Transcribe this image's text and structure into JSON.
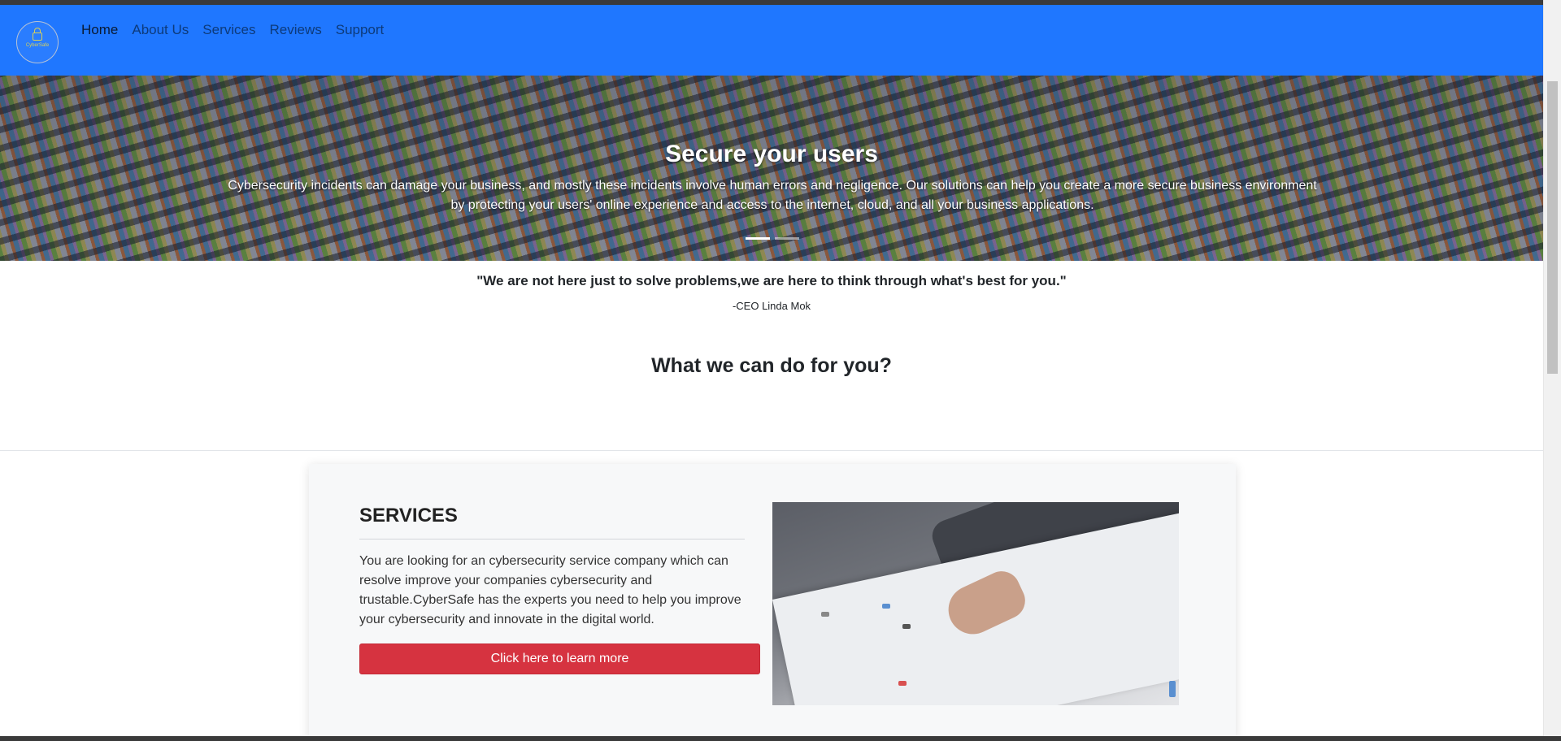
{
  "nav": {
    "logo_text": "CyberSafe",
    "links": [
      "Home",
      "About Us",
      "Services",
      "Reviews",
      "Support"
    ],
    "active_index": 0
  },
  "hero": {
    "title": "Secure your users",
    "text": "Cybersecurity incidents can damage your business, and mostly these incidents involve human errors and negligence. Our solutions can help you create a more secure business environment by protecting your users' online experience and access to the internet, cloud, and all your business applications.",
    "slides": 2,
    "active_slide": 0
  },
  "quote": {
    "text": "\"We are not here just to solve problems,we are here to think through what's best for you.\"",
    "author": "-CEO Linda Mok"
  },
  "section_heading": "What we can do for you?",
  "services_card": {
    "title": "SERVICES",
    "body": "You are looking for an cybersecurity service company which can resolve improve your companies cybersecurity and trustable.CyberSafe has the experts you need to help you improve your cybersecurity and innovate in the digital world.",
    "button_label": "Click here to learn more"
  },
  "colors": {
    "navbar": "#1f77ff",
    "button": "#d63340"
  }
}
